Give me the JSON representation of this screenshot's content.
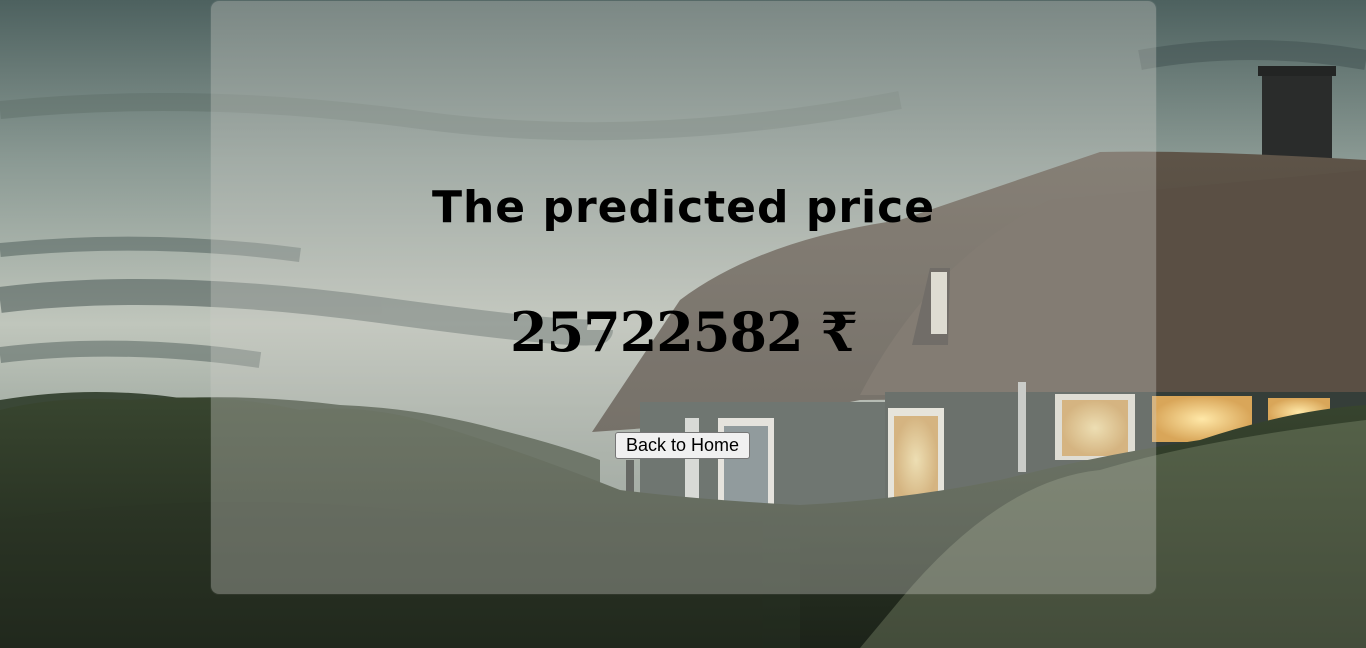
{
  "result": {
    "heading": "The predicted price",
    "price": "25722582 ₹",
    "back_button_label": "Back to Home"
  },
  "colors": {
    "sky_top": "#5c706d",
    "sky_mid": "#b7bfb5",
    "hill": "#2f3b2e",
    "house_wall": "#3d4640",
    "roof": "#6b5d4f",
    "window_glow": "#f6d08a",
    "card_tint": "#cececa"
  }
}
